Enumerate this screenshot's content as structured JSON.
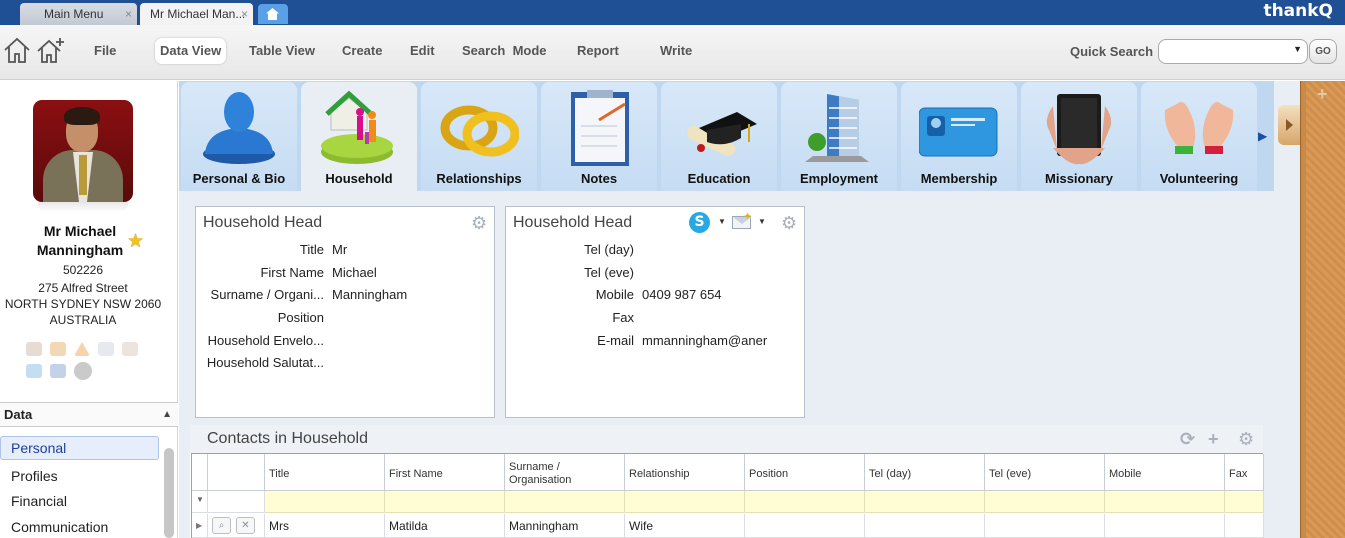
{
  "browser_tabs": [
    {
      "title": "Main Menu",
      "close": "×"
    },
    {
      "title": "Mr Michael Man...",
      "close": "×"
    }
  ],
  "brand": "thankQ",
  "toolbar": {
    "menu": [
      "File",
      "Data View",
      "Table View",
      "Create",
      "Edit",
      "Search  Mode",
      "Report",
      "Write"
    ],
    "active_menu": "Data View",
    "quick_search_label": "Quick Search",
    "quick_search_value": "",
    "go_label": "GO"
  },
  "profile": {
    "name_line1": "Mr Michael",
    "name_line2": "Manningham",
    "id": "502226",
    "address1": "275 Alfred Street",
    "address2": "NORTH SYDNEY NSW 2060",
    "country": "AUSTRALIA"
  },
  "data_section": {
    "heading": "Data",
    "items": [
      "Personal",
      "Profiles",
      "Financial",
      "Communication"
    ],
    "selected": "Personal"
  },
  "ribbon_tabs": [
    "Personal & Bio",
    "Household",
    "Relationships",
    "Notes",
    "Education",
    "Employment",
    "Membership",
    "Missionary",
    "Volunteering"
  ],
  "active_ribbon_tab": "Household",
  "household_head_left": {
    "title": "Household Head",
    "fields": [
      {
        "label": "Title",
        "value": "Mr"
      },
      {
        "label": "First Name",
        "value": "Michael"
      },
      {
        "label": "Surname / Organi...",
        "value": "Manningham"
      },
      {
        "label": "Position",
        "value": ""
      },
      {
        "label": "Household Envelo...",
        "value": ""
      },
      {
        "label": "Household Salutat...",
        "value": ""
      }
    ]
  },
  "household_head_right": {
    "title": "Household Head",
    "fields": [
      {
        "label": "Tel (day)",
        "value": ""
      },
      {
        "label": "Tel (eve)",
        "value": ""
      },
      {
        "label": "Mobile",
        "value": "0409 987 654"
      },
      {
        "label": "Fax",
        "value": ""
      },
      {
        "label": "E-mail",
        "value": "mmanningham@aner"
      }
    ]
  },
  "contacts": {
    "title": "Contacts in Household",
    "columns": [
      "Title",
      "First Name",
      "Surname / Organisation",
      "Relationship",
      "Position",
      "Tel (day)",
      "Tel (eve)",
      "Mobile",
      "Fax"
    ],
    "rows": [
      [
        "Mrs",
        "Matilda",
        "Manningham",
        "Wife",
        "",
        "",
        "",
        "",
        ""
      ]
    ]
  }
}
